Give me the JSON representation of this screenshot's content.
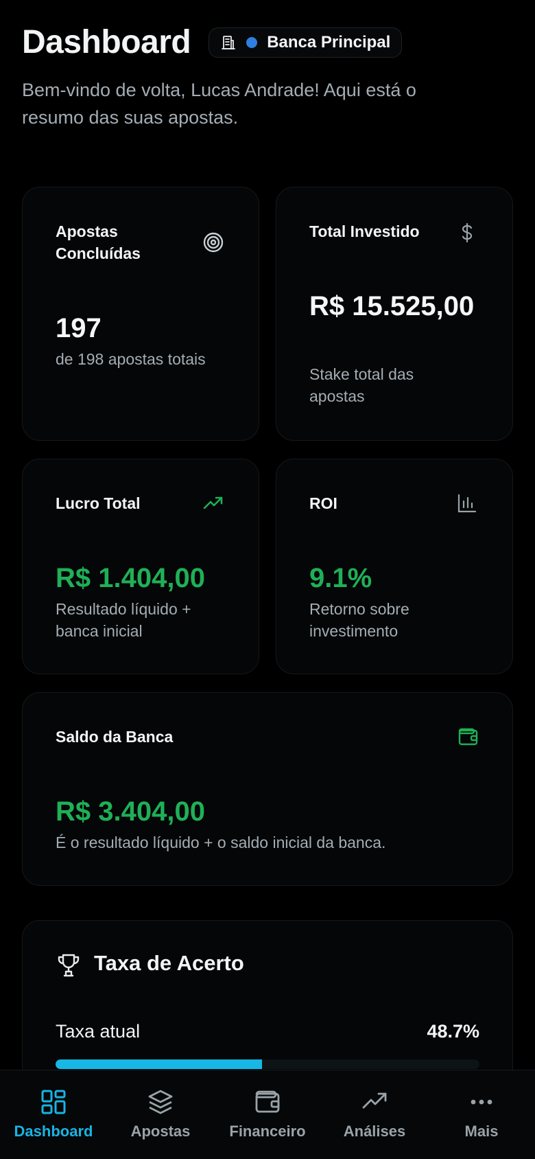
{
  "header": {
    "title": "Dashboard",
    "bank_chip": {
      "name": "Banca Principal",
      "icon": "building-icon",
      "dot_color": "#2f7fe0"
    },
    "subtitle": "Bem-vindo de volta, Lucas Andrade! Aqui está o resumo das suas apostas."
  },
  "cards": {
    "apostas": {
      "label": "Apostas Concluídas",
      "value": "197",
      "desc": "de 198 apostas totais",
      "icon": "target-icon"
    },
    "investido": {
      "label": "Total Investido",
      "value": "R$ 15.525,00",
      "desc": "Stake total das apostas",
      "icon": "dollar-icon"
    },
    "lucro": {
      "label": "Lucro Total",
      "value": "R$ 1.404,00",
      "desc": "Resultado líquido + banca inicial",
      "icon": "trending-up-icon"
    },
    "roi": {
      "label": "ROI",
      "value": "9.1%",
      "desc": "Retorno sobre investimento",
      "icon": "bar-chart-icon"
    },
    "saldo": {
      "label": "Saldo da Banca",
      "value": "R$ 3.404,00",
      "desc": "É o resultado líquido + o saldo inicial da banca.",
      "icon": "wallet-icon"
    }
  },
  "hit_rate": {
    "title": "Taxa de Acerto",
    "icon": "trophy-icon",
    "current_label": "Taxa atual",
    "current_value": "48.7%",
    "progress_percent": 48.7
  },
  "nav": [
    {
      "label": "Dashboard",
      "icon": "dashboard-icon",
      "active": true
    },
    {
      "label": "Apostas",
      "icon": "layers-icon",
      "active": false
    },
    {
      "label": "Financeiro",
      "icon": "wallet-icon",
      "active": false
    },
    {
      "label": "Análises",
      "icon": "trending-up-icon",
      "active": false
    },
    {
      "label": "Mais",
      "icon": "more-icon",
      "active": false
    }
  ],
  "colors": {
    "accent": "#18b4e3",
    "positive": "#1fb057",
    "background": "#000000"
  }
}
